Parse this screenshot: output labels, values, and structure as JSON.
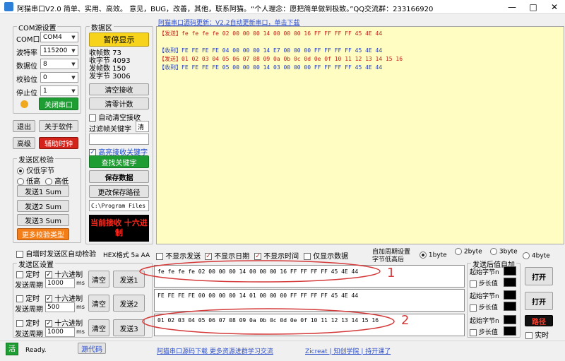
{
  "app": {
    "title": "阿猫串口V2.0  简单、实用、高效。 意见，BUG，改善，其他，联系阿猫。“个人理念：愿把简单做到极致。”QQ交流群：233166920",
    "min": "—",
    "max": "□",
    "close": "✕"
  },
  "com": {
    "group_title": "COM源设置",
    "com_label": "COM口",
    "com_value": "COM4",
    "baud_label": "波特率",
    "baud_value": "115200",
    "data_label": "数据位",
    "data_value": "8",
    "parity_label": "校验位",
    "parity_value": "0",
    "stop_label": "停止位",
    "stop_value": "1",
    "close_port": "关闭串口",
    "status_color": "#f0a81e"
  },
  "left_buttons": {
    "exit": "退出",
    "about": "关于软件",
    "advanced": "高级",
    "assist_clock": "辅助时钟"
  },
  "checksum": {
    "group_title": "发送区校验",
    "only_low": "仅低字节",
    "low_high": "低高",
    "high_low": "高低",
    "send1": "发送1 Sum",
    "send2": "发送2 Sum",
    "send3": "发送3 Sum",
    "more": "更多校验类型"
  },
  "data": {
    "group_title": "数据区",
    "pause": "暂停显示",
    "recv_frames": "收帧数 73",
    "recv_bytes": "收字节 4093",
    "send_frames": "发帧数 150",
    "send_bytes": "发字节 3006",
    "clear_recv": "清空接收",
    "clear_count": "清零计数",
    "auto_clear": "自动清空接收",
    "filter_label": "过滤帧关键字",
    "filter_value": "清",
    "highlight": "高亮接收关键字",
    "find": "查找关键字",
    "save": "保存数据",
    "change_path": "更改保存路径",
    "path": "C:\\Program Files",
    "hex_notice": "当前接收 十六进制"
  },
  "top_link": "阿猫串口源码更新：V2.2自动更新串口，单击下载",
  "receive": {
    "lines": [
      {
        "tag": "【发送】",
        "text": "fe fe fe fe 02 00 00 00 14 00 00 00 16 FF FF FF FF 45 4E 44",
        "color": "#c0201a"
      },
      {
        "tag": "",
        "text": "",
        "color": "#000"
      },
      {
        "tag": "【收到】",
        "text": "FE FE FE FE 04 00 00 00 14 E7 00 00 00 FF FF FF FF 45 4E 44",
        "color": "#1d39c4"
      },
      {
        "tag": "【发送】",
        "text": "01 02 03 04 05 06 07 08 09 0a 0b 0c 0d 0e 0f 10 11 12 13 14 15 16",
        "color": "#c0201a"
      },
      {
        "tag": "【收到】",
        "text": "FE FE FE FE 05 00 00 00 14 03 00 00 00 FF FF FF FF 45 4E 44",
        "color": "#1d39c4"
      }
    ]
  },
  "options": {
    "auto_inc": "自增时发送区自动检验",
    "hex_fmt": "HEX格式 5a AA",
    "no_send": "不显示发送",
    "no_date": "不显示日期",
    "no_time": "不显示时间",
    "only_data": "仅显示数据",
    "period_label1": "自加周期设置",
    "period_label2": "字节低高后",
    "b1": "1byte",
    "b2": "2byte",
    "b3": "3byte",
    "b4": "4byte"
  },
  "send": {
    "group_title": "发送区设置",
    "timer": "定时",
    "hex": "十六进制",
    "period": "发送周期",
    "ms": "ms",
    "clear": "清空",
    "rows": [
      {
        "period": "1000",
        "button": "发送1",
        "content": "fe fe fe fe 02 00 00 00 14 00 00 00 16 FF FF FF FF 45 4E 44"
      },
      {
        "period": "500",
        "button": "发送2",
        "content": "FE FE FE FE 00 00 00 00 14 01 00 00 00 FF FF FF FF 45 4E 44"
      },
      {
        "period": "1000",
        "button": "发送3",
        "content": "01 02 03 04 05 06 07 08 09 0a 0b 0c 0d 0e 0f 10 11 12 13 14 15 16"
      }
    ]
  },
  "auto_add": {
    "group_title": "发送后值自加",
    "start_byte": "起始字节n",
    "step": "步长值",
    "open": "打开",
    "path": "路径",
    "realtime": "实时"
  },
  "annotations": {
    "one": "1",
    "two": "2"
  },
  "status": {
    "badge": "活",
    "ready": "Ready.",
    "source": "源代码",
    "link1": "阿猫串口源码下载 更多资源进群学习交流",
    "link2": "Zicreat | 知创学院 | 持开课了"
  }
}
